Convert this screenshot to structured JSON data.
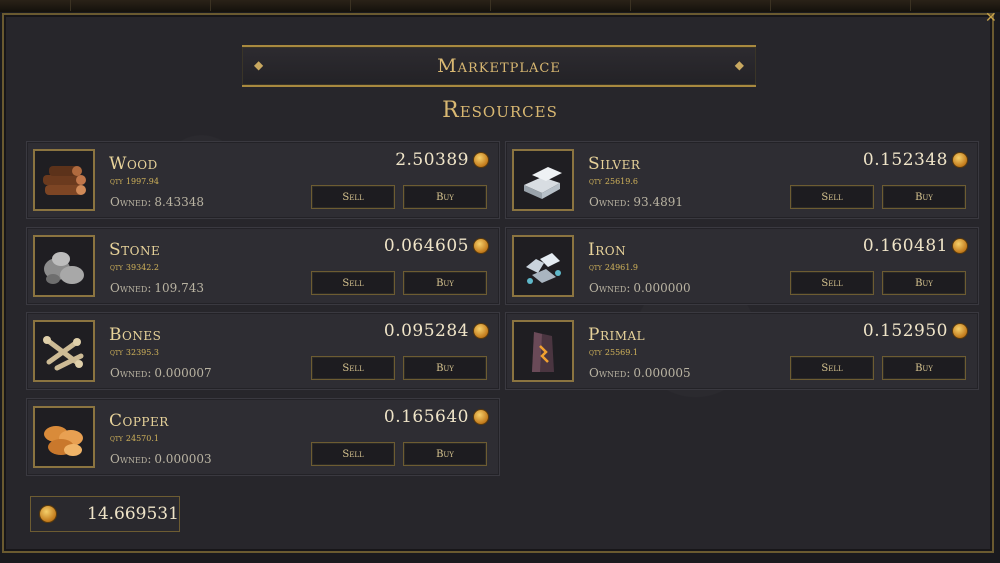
{
  "window": {
    "title": "Marketplace",
    "section": "Resources",
    "close_glyph": "✕"
  },
  "labels": {
    "qty": "qty",
    "owned": "Owned:",
    "sell": "Sell",
    "buy": "Buy"
  },
  "colors": {
    "accent": "#d9b872",
    "border": "#8b7440",
    "panel": "#27262b"
  },
  "resources": [
    {
      "id": "wood",
      "name": "Wood",
      "qty": "1997.94",
      "owned": "8.43348",
      "price": "2.50389",
      "icon": "wood-icon"
    },
    {
      "id": "stone",
      "name": "Stone",
      "qty": "39342.2",
      "owned": "109.743",
      "price": "0.064605",
      "icon": "stone-icon"
    },
    {
      "id": "bones",
      "name": "Bones",
      "qty": "32395.3",
      "owned": "0.000007",
      "price": "0.095284",
      "icon": "bones-icon"
    },
    {
      "id": "copper",
      "name": "Copper",
      "qty": "24570.1",
      "owned": "0.000003",
      "price": "0.165640",
      "icon": "copper-icon"
    },
    {
      "id": "silver",
      "name": "Silver",
      "qty": "25619.6",
      "owned": "93.4891",
      "price": "0.152348",
      "icon": "silver-icon"
    },
    {
      "id": "iron",
      "name": "Iron",
      "qty": "24961.9",
      "owned": "0.000000",
      "price": "0.160481",
      "icon": "iron-icon"
    },
    {
      "id": "primal",
      "name": "Primal",
      "qty": "25569.1",
      "owned": "0.000005",
      "price": "0.152950",
      "icon": "primal-icon"
    }
  ],
  "balance": {
    "value": "14.669531",
    "icon": "coin-icon"
  }
}
